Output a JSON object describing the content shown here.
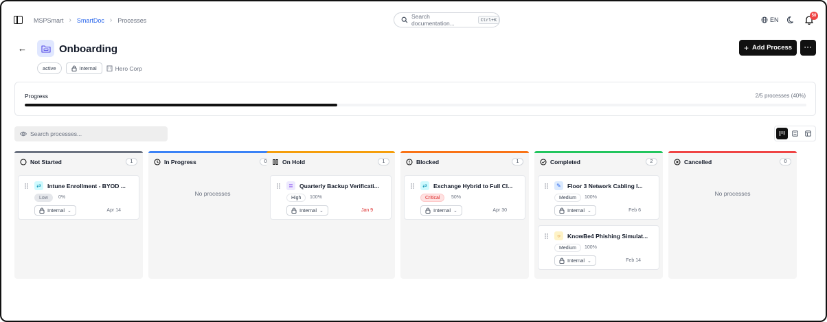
{
  "breadcrumb": [
    "MSPSmart",
    "SmartDoc",
    "Processes"
  ],
  "search_docs": {
    "placeholder": "Search documentation...",
    "shortcut": "Ctrl+K"
  },
  "lang": "EN",
  "notifications": "50",
  "header": {
    "title": "Onboarding",
    "status": "active",
    "visibility": "Internal",
    "client": "Hero Corp",
    "add_label": "Add Process",
    "more_label": "···"
  },
  "progress": {
    "label": "Progress",
    "summary": "2/5 processes (40%)",
    "percent": 40
  },
  "search_processes": {
    "placeholder": "Search processes..."
  },
  "colors": {
    "not_started": "#6b7280",
    "in_progress": "#3b82f6",
    "on_hold": "#f59e0b",
    "blocked": "#f97316",
    "completed": "#22c55e",
    "cancelled": "#ef4444",
    "critical": "#dc2626"
  },
  "columns": [
    {
      "title": "Not Started",
      "count": "1",
      "icon": "circle-icon",
      "empty": "",
      "cards": [
        {
          "title": "Intune Enrollment - BYOD ...",
          "priority": "Low",
          "pct": "0%",
          "access": "Internal",
          "date": "Apr 14",
          "icon": "sync-icon"
        }
      ]
    },
    {
      "title": "In Progress",
      "count": "0",
      "icon": "clock-icon",
      "empty": "No processes",
      "cards": []
    },
    {
      "title": "On Hold",
      "count": "1",
      "icon": "pause-icon",
      "empty": "",
      "cards": [
        {
          "title": "Quarterly Backup Verificati...",
          "priority": "High",
          "pct": "100%",
          "access": "Internal",
          "date": "Jan 9",
          "icon": "database-icon"
        }
      ]
    },
    {
      "title": "Blocked",
      "count": "1",
      "icon": "alert-circle-icon",
      "empty": "",
      "cards": [
        {
          "title": "Exchange Hybrid to Full Cl...",
          "priority": "Critical",
          "pct": "50%",
          "access": "Internal",
          "date": "Apr 30",
          "icon": "sync-icon"
        }
      ]
    },
    {
      "title": "Completed",
      "count": "2",
      "icon": "check-circle-icon",
      "empty": "",
      "cards": [
        {
          "title": "Floor 3 Network Cabling I...",
          "priority": "Medium",
          "pct": "100%",
          "access": "Internal",
          "date": "Feb 6",
          "icon": "wrench-icon"
        },
        {
          "title": "KnowBe4 Phishing Simulat...",
          "priority": "Medium",
          "pct": "100%",
          "access": "Internal",
          "date": "Feb 14",
          "icon": "circle-outline-icon"
        }
      ]
    },
    {
      "title": "Cancelled",
      "count": "0",
      "icon": "x-circle-icon",
      "empty": "No processes",
      "cards": []
    }
  ]
}
